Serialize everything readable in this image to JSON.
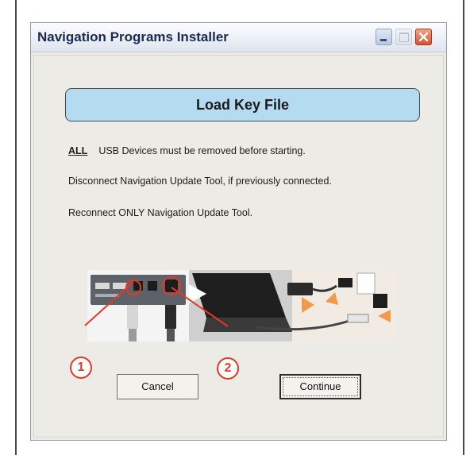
{
  "window": {
    "title": "Navigation Programs Installer"
  },
  "banner": {
    "title": "Load Key File"
  },
  "instructions": {
    "line1_emphasis": "ALL",
    "line1_rest": "USB Devices must be removed before starting.",
    "line2": "Disconnect Navigation Update Tool, if previously connected.",
    "line3": "Reconnect ONLY Navigation Update Tool."
  },
  "callouts": {
    "first": "1",
    "second": "2"
  },
  "buttons": {
    "cancel": "Cancel",
    "continue": "Continue"
  },
  "icons": {
    "minimize": "minimize-icon",
    "maximize": "maximize-icon",
    "close": "close-icon"
  },
  "colors": {
    "banner": "#b5dbf0",
    "callout": "#e03a25",
    "close_button": "#d9532c"
  }
}
